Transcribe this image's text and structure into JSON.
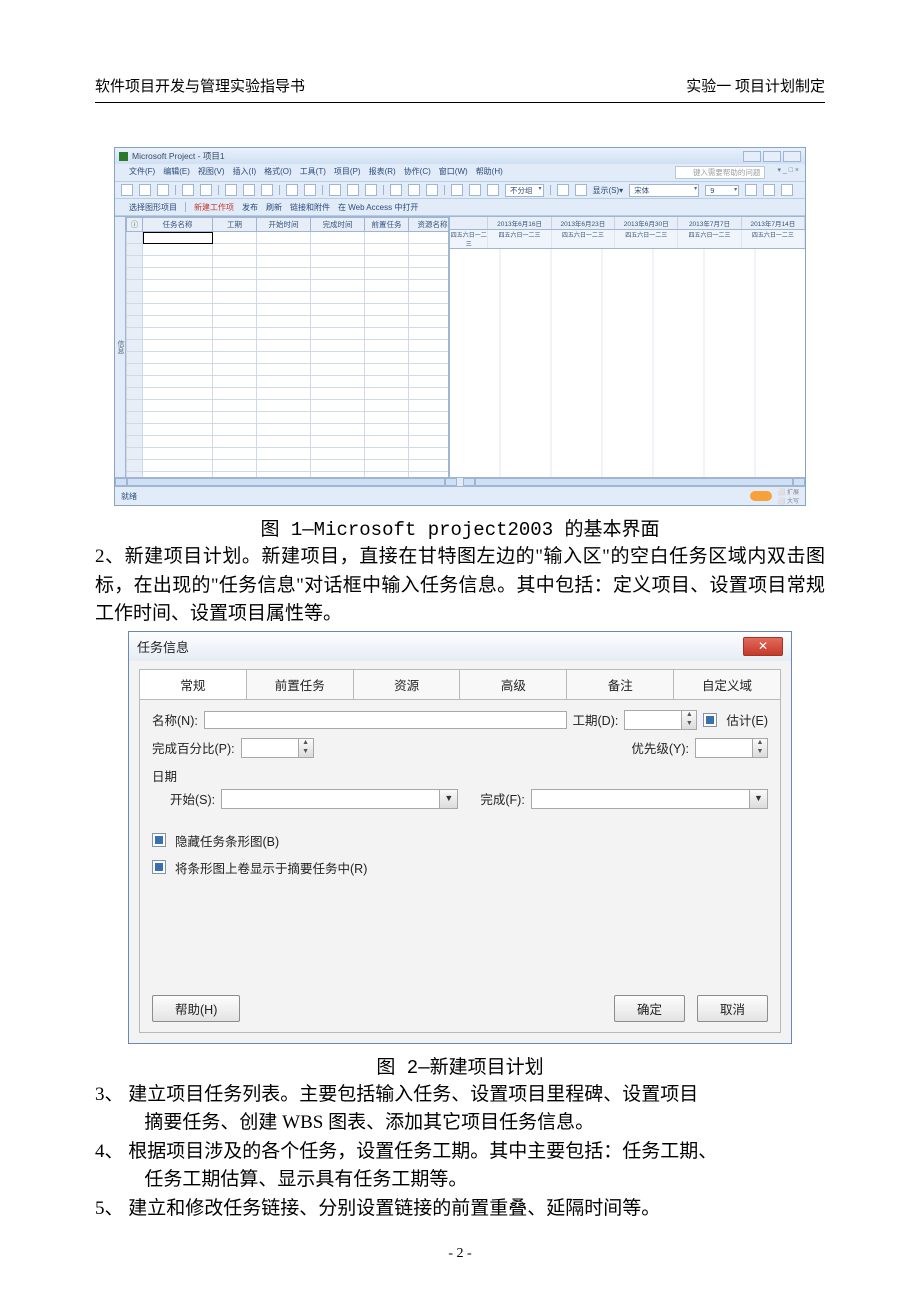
{
  "doc": {
    "header_left": "软件项目开发与管理实验指导书",
    "header_right": "实验一 项目计划制定",
    "page_number": "- 2 -"
  },
  "fig1": {
    "caption": "图 1—Microsoft project2003 的基本界面",
    "title": "Microsoft Project - 项目1",
    "menus": [
      "文件(F)",
      "编辑(E)",
      "视图(V)",
      "插入(I)",
      "格式(O)",
      "工具(T)",
      "项目(P)",
      "报表(R)",
      "协作(C)",
      "窗口(W)",
      "帮助(H)"
    ],
    "help_placeholder": "键入需要帮助的问题",
    "mdi_hint": "▾ _ □ ×",
    "toolbar_group_label": "不分组",
    "toolbar_show_label": "显示(S)▾",
    "toolbar_font": "宋体",
    "toolbar_size": "9",
    "toolbar2": [
      "选择图形项目",
      "新建工作项",
      "发布",
      "刷新",
      "链接和附件",
      "在 Web Access 中打开"
    ],
    "grid_columns": [
      "",
      "任务名称",
      "工期",
      "开始时间",
      "完成时间",
      "前置任务",
      "资源名称"
    ],
    "gantt_weeks": [
      "2013年6月16日",
      "2013年6月23日",
      "2013年6月30日",
      "2013年7月7日",
      "2013年7月14日"
    ],
    "gantt_days": "四五六日一二三",
    "status": "就绪",
    "section_label": "信息"
  },
  "body": {
    "p2_start": "2、新建项目计划。新建项目，直接在甘特图左边的\"输入区\"的空白任务区域内双击图标，在出现的\"任务信息\"对话框中输入任务信息。其中包括：定义项目、设置项目常规工作时间、设置项目属性等。",
    "p3_l1": "3、 建立项目任务列表。主要包括输入任务、设置项目里程碑、设置项目",
    "p3_l2": "摘要任务、创建 WBS 图表、添加其它项目任务信息。",
    "p4_l1": "4、 根据项目涉及的各个任务，设置任务工期。其中主要包括：任务工期、",
    "p4_l2": "任务工期估算、显示具有任务工期等。",
    "p5": "5、 建立和修改任务链接、分别设置链接的前置重叠、延隔时间等。"
  },
  "fig2": {
    "caption": "图 2—新建项目计划",
    "title": "任务信息",
    "tabs": [
      "常规",
      "前置任务",
      "资源",
      "高级",
      "备注",
      "自定义域"
    ],
    "name_label": "名称(N):",
    "duration_label": "工期(D):",
    "estimate_label": "估计(E)",
    "percent_label": "完成百分比(P):",
    "priority_label": "优先级(Y):",
    "date_label": "日期",
    "start_label": "开始(S):",
    "finish_label": "完成(F):",
    "opt_hide_bar": "隐藏任务条形图(B)",
    "opt_rollup": "将条形图上卷显示于摘要任务中(R)",
    "btn_help": "帮助(H)",
    "btn_ok": "确定",
    "btn_cancel": "取消"
  }
}
